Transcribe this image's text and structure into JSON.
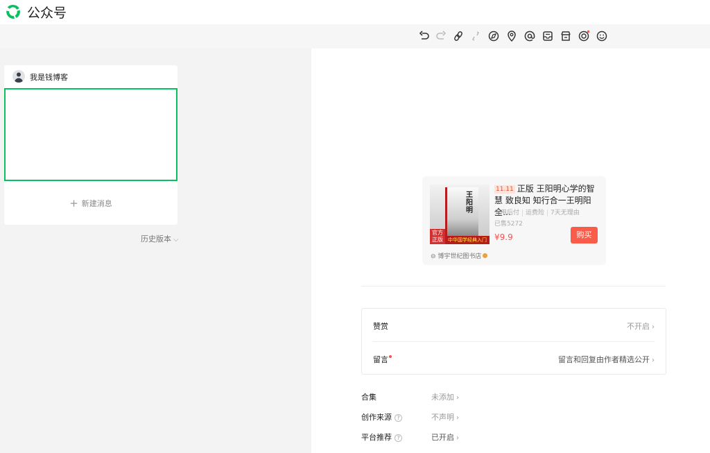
{
  "app": {
    "brand": "公众号"
  },
  "toolbar": {
    "icons": [
      "undo-icon",
      "redo-icon",
      "link-icon",
      "unlink-icon",
      "compass-icon",
      "location-icon",
      "at-icon",
      "inbox-icon",
      "shop-icon",
      "target-icon",
      "emoji-icon"
    ]
  },
  "editor": {
    "author": "我是钱博客",
    "new_message": "新建消息",
    "history": "历史版本"
  },
  "product": {
    "promo_tag": "11.11",
    "title": "正版 王阳明心学的智慧 致良知 知行合一王明阳全…",
    "tags": [
      "先用后付",
      "运费险",
      "7天无理由"
    ],
    "sold": "已售5272",
    "price": "¥9.9",
    "buy_label": "购买",
    "shop": "博宇世纪图书店",
    "cover": {
      "title": "王阳明",
      "badge": "官方正版",
      "strip": "中华国学经典入门"
    }
  },
  "settings": {
    "reward": {
      "label": "赞赏",
      "value": "不开启"
    },
    "comment": {
      "label": "留言",
      "value": "留言和回复由作者精选公开"
    }
  },
  "meta": {
    "collection": {
      "label": "合集",
      "value": "未添加"
    },
    "source": {
      "label": "创作来源",
      "value": "不声明"
    },
    "recommend": {
      "label": "平台推荐",
      "value": "已开启"
    }
  },
  "colors": {
    "accent": "#07c160",
    "price": "#fa5151",
    "buy": "#fa5c4a"
  }
}
